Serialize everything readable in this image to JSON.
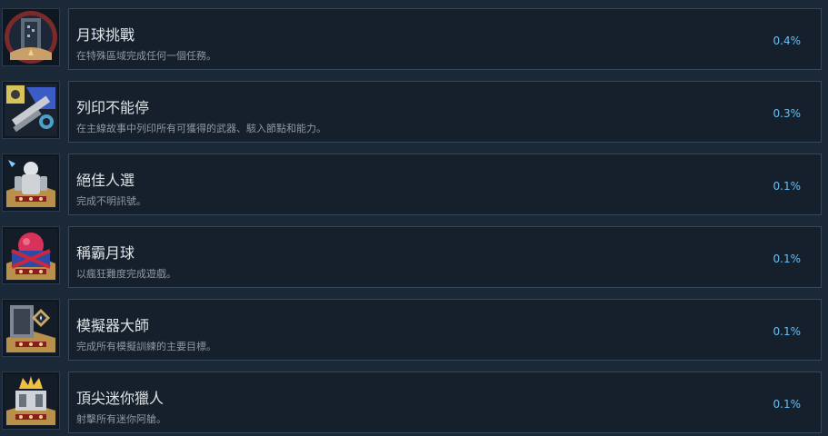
{
  "achievements": [
    {
      "title": "月球挑戰",
      "description": "在特殊區域完成任何一個任務。",
      "percent": "0.4%",
      "icon": "moon-tower-badge-icon"
    },
    {
      "title": "列印不能停",
      "description": "在主線故事中列印所有可獲得的武器、駭入節點和能力。",
      "percent": "0.3%",
      "icon": "printer-weapons-badge-icon"
    },
    {
      "title": "絕佳人選",
      "description": "完成不明訊號。",
      "percent": "0.1%",
      "icon": "armored-soldier-badge-icon"
    },
    {
      "title": "稱霸月球",
      "description": "以瘋狂難度完成遊戲。",
      "percent": "0.1%",
      "icon": "red-moon-badge-icon"
    },
    {
      "title": "模擬器大師",
      "description": "完成所有模擬訓練的主要目標。",
      "percent": "0.1%",
      "icon": "simulator-badge-icon"
    },
    {
      "title": "頂尖迷你獵人",
      "description": "射擊所有迷你阿艙。",
      "percent": "0.1%",
      "icon": "crown-hunter-badge-icon"
    }
  ]
}
